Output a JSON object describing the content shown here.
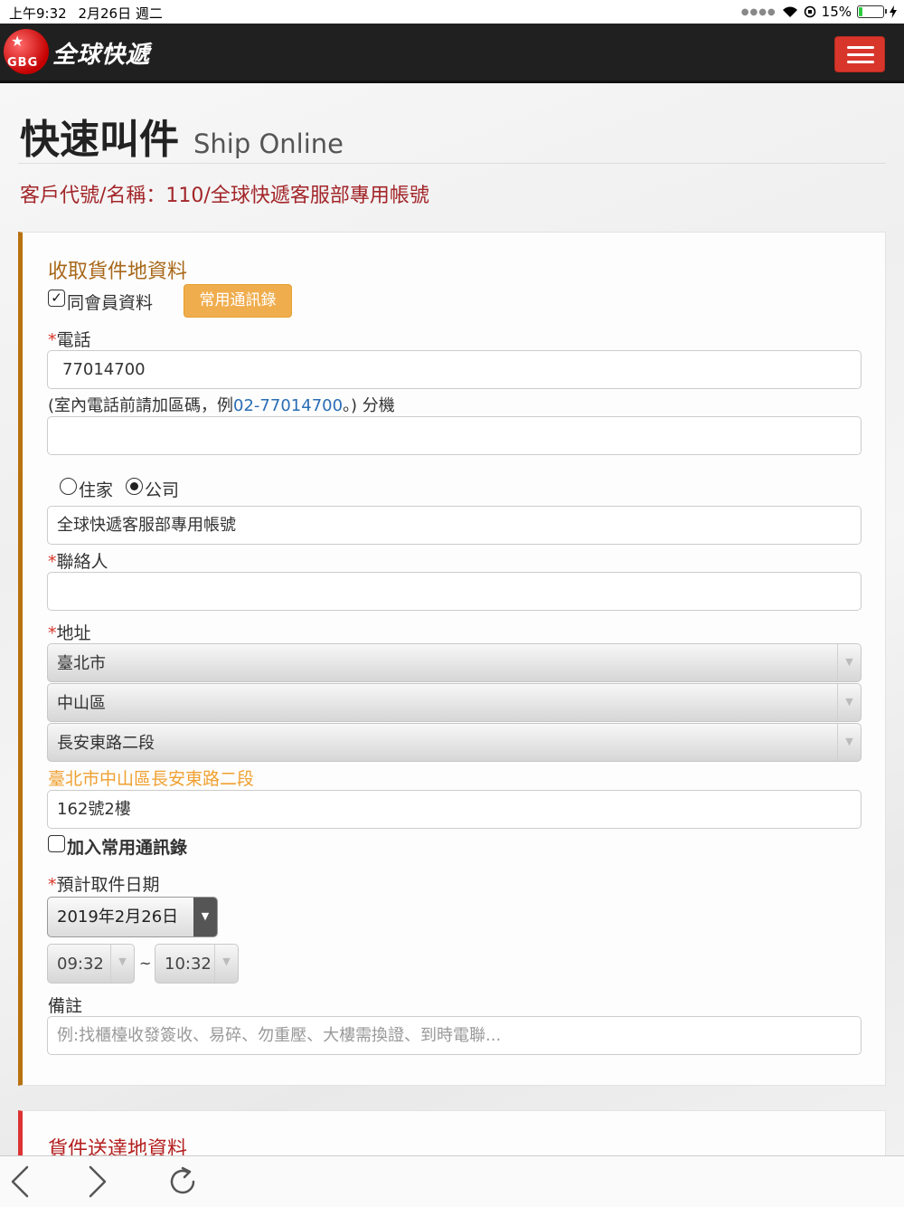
{
  "status_bar": {
    "time": "上午9:32",
    "date": "2月26日 週二",
    "battery": "15%",
    "battery_level": 0.15
  },
  "header": {
    "logo_badge": "GBG",
    "logo_text": "全球快遞",
    "menu_icon": "hamburger-menu-icon"
  },
  "page": {
    "title_zh": "快速叫件",
    "title_en": "Ship Online",
    "customer_line": "客戶代號/名稱：110/全球快遞客服部專用帳號"
  },
  "pickup": {
    "section_title": "收取貨件地資料",
    "same_as_member_label": "同會員資料",
    "same_as_member_checked": true,
    "address_book_button": "常用通訊錄",
    "phone_required_mark": "*",
    "phone_label": "電話",
    "phone_value": "77014700",
    "phone_hint_prefix": "(室內電話前請加區碼，例",
    "phone_hint_example": "02-77014700",
    "phone_hint_suffix": "。) 分機",
    "extension_value": "",
    "type_home_label": "住家",
    "type_company_label": "公司",
    "type_selected": "公司",
    "company_value": "全球快遞客服部專用帳號",
    "contact_required_mark": "*",
    "contact_label": "聯絡人",
    "contact_value": "",
    "address_required_mark": "*",
    "address_label": "地址",
    "city": "臺北市",
    "district": "中山區",
    "road": "長安東路二段",
    "address_preview": "臺北市中山區長安東路二段",
    "address_detail": "162號2樓",
    "add_to_book_label": "加入常用通訊錄",
    "add_to_book_checked": false,
    "date_required_mark": "*",
    "date_label": "預計取件日期",
    "date_value": "2019年2月26日",
    "time_from": "09:32",
    "time_sep": "~",
    "time_to": "10:32",
    "notes_label": "備註",
    "notes_placeholder": "例:找櫃檯收發簽收、易碎、勿重壓、大樓需換證、到時電聯..."
  },
  "delivery": {
    "section_title": "貨件送達地資料"
  },
  "colors": {
    "accent_red": "#d9362b",
    "section_brown": "#b8720f",
    "button_orange": "#f0ad4e",
    "link_blue": "#2a6db5"
  }
}
